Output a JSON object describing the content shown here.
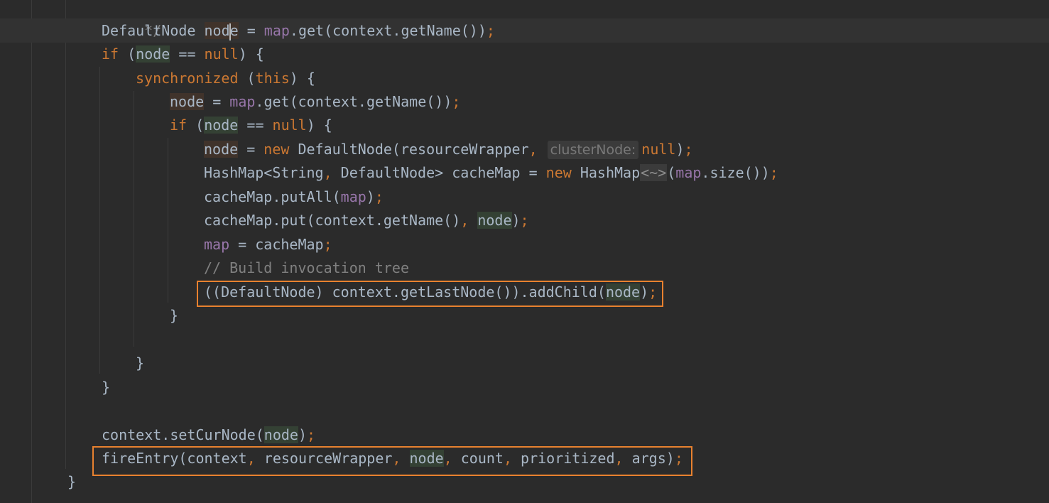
{
  "editor": {
    "lines": {
      "doc_end": "*/",
      "l1_type": "DefaultNode ",
      "l1_var_a": "nod",
      "l1_var_b": "e",
      "l1_eq": " = ",
      "l1_map": "map",
      "l1_call": ".get(context.getName())",
      "l1_semi": ";",
      "l2_if": "if",
      "l2_open": " (",
      "l2_node": "node",
      "l2_eq": " == ",
      "l2_null": "null",
      "l2_close": ") {",
      "l3_sync": "synchronized",
      "l3_open": " (",
      "l3_this": "this",
      "l3_close": ") {",
      "l4_node": "node",
      "l4_eq": " = ",
      "l4_map": "map",
      "l4_call": ".get(context.getName())",
      "l4_semi": ";",
      "l5_if": "if",
      "l5_open": " (",
      "l5_node": "node",
      "l5_eq": " == ",
      "l5_null": "null",
      "l5_close": ") {",
      "l6_node": "node",
      "l6_eq": " = ",
      "l6_new": "new",
      "l6_ctor": " DefaultNode(resourceWrapper",
      "l6_comma": ",",
      "l6_hint": "clusterNode:",
      "l6_null": "null",
      "l6_close": ")",
      "l6_semi": ";",
      "l7_decl": "HashMap<String",
      "l7_comma": ",",
      "l7_decl2": " DefaultNode> cacheMap = ",
      "l7_new": "new",
      "l7_type": " HashMap",
      "l7_fold": "<~>",
      "l7_open": "(",
      "l7_map": "map",
      "l7_call": ".size())",
      "l7_semi": ";",
      "l8_call": "cacheMap.putAll(",
      "l8_map": "map",
      "l8_close": ")",
      "l8_semi": ";",
      "l9_call": "cacheMap.put(context.getName()",
      "l9_comma": ",",
      "l9_sp": " ",
      "l9_node": "node",
      "l9_close": ")",
      "l9_semi": ";",
      "l10_map": "map",
      "l10_rest": " = cacheMap",
      "l10_semi": ";",
      "l11_comment": "// Build invocation tree",
      "l12_call": "((DefaultNode) context.getLastNode()).addChild(",
      "l12_node": "node",
      "l12_close": ")",
      "l12_semi": ";",
      "l13_brace": "}",
      "l15_brace": "}",
      "l16_brace": "}",
      "l18_call": "context.setCurNode(",
      "l18_node": "node",
      "l18_close": ")",
      "l18_semi": ";",
      "l19_call": "fireEntry(context",
      "l19_c1": ",",
      "l19_rw": " resourceWrapper",
      "l19_c2": ",",
      "l19_sp": " ",
      "l19_node": "node",
      "l19_c3": ",",
      "l19_count": " count",
      "l19_c4": ",",
      "l19_prio": " prioritized",
      "l19_c5": ",",
      "l19_args": " args)",
      "l19_semi": ";",
      "l20_brace": "}"
    },
    "colors": {
      "background": "#2b2b2b",
      "keyword": "#cc7832",
      "field": "#9876aa",
      "comment": "#808080",
      "highlight_box": "#e8812f"
    }
  }
}
